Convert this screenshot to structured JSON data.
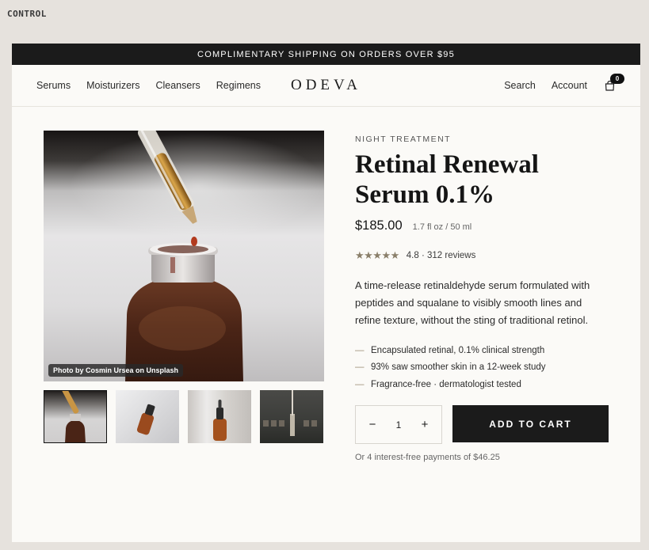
{
  "control_label": "CONTROL",
  "announcement": "COMPLIMENTARY SHIPPING ON ORDERS OVER $95",
  "nav": {
    "left_items": [
      "Serums",
      "Moisturizers",
      "Cleansers",
      "Regimens"
    ],
    "logo": "ODEVA",
    "search": "Search",
    "account": "Account",
    "cart_count": "0"
  },
  "gallery": {
    "photo_credit": "Photo by Cosmin Ursea on Unsplash",
    "thumbnail_count": 4,
    "active_thumbnail": 1
  },
  "product": {
    "eyebrow": "NIGHT TREATMENT",
    "title": "Retinal Renewal Serum 0.1%",
    "price": "$185.00",
    "size": "1.7 fl oz / 50 ml",
    "stars": "★★★★★",
    "rating_text": "4.8 · 312 reviews",
    "description": "A time-release retinaldehyde serum formulated with peptides and squalane to visibly smooth lines and refine texture, without the sting of traditional retinol.",
    "bullet_marker": "—",
    "bullets": [
      "Encapsulated retinal, 0.1% clinical strength",
      "93% saw smoother skin in a 12-week study",
      "Fragrance-free · dermatologist tested"
    ],
    "qty_minus": "−",
    "quantity": "1",
    "qty_plus": "+",
    "add_to_cart": "ADD TO CART",
    "installments": "Or 4 interest-free payments of $46.25"
  },
  "colors": {
    "accent_dark": "#1b1b1b",
    "star_color": "#8a7f6a",
    "background": "#fbfaf7",
    "outer_background": "#e6e2dd"
  }
}
